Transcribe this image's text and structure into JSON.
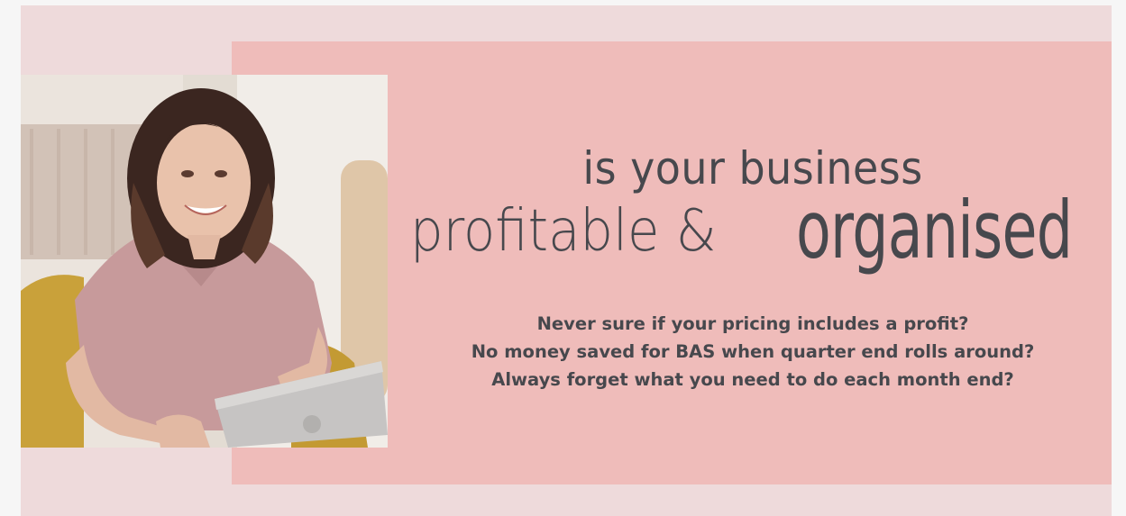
{
  "headline": {
    "line1": "is your business",
    "line2_part1": "profitable &",
    "line2_part2": "organised"
  },
  "questions": [
    "Never sure if your pricing includes a profit?",
    "No money saved for BAS when quarter end rolls around?",
    "Always forget what you need to do each month end?"
  ],
  "colors": {
    "background": "#f6f6f6",
    "outer_panel": "#eedadb",
    "pink_panel": "#efbcba",
    "text": "#47484d"
  }
}
